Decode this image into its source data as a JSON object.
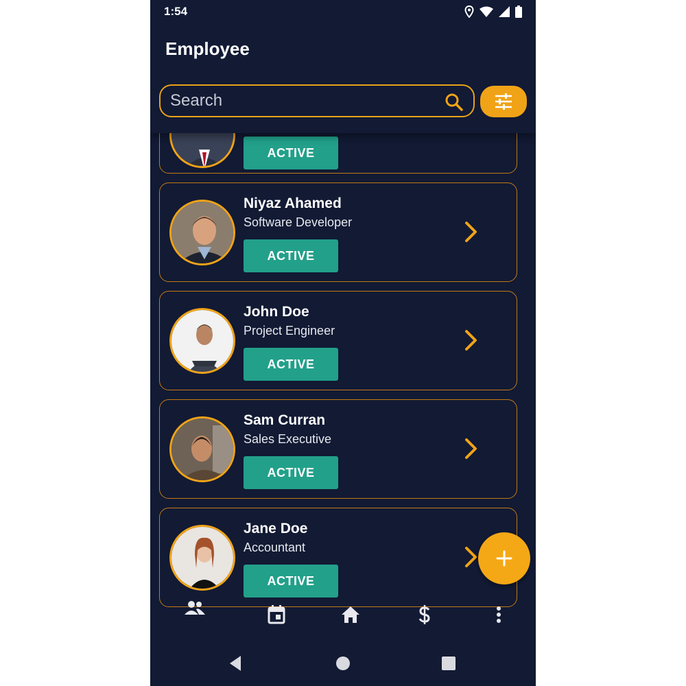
{
  "status": {
    "time": "1:54"
  },
  "app": {
    "title": "Employee"
  },
  "search": {
    "placeholder": "Search"
  },
  "employees": [
    {
      "name": "",
      "role": "",
      "status": "ACTIVE"
    },
    {
      "name": "Niyaz Ahamed",
      "role": "Software Developer",
      "status": "ACTIVE"
    },
    {
      "name": "John Doe",
      "role": "Project Engineer",
      "status": "ACTIVE"
    },
    {
      "name": "Sam Curran",
      "role": "Sales Executive",
      "status": "ACTIVE"
    },
    {
      "name": "Jane Doe",
      "role": "Accountant",
      "status": "ACTIVE"
    }
  ],
  "bottom_nav": [
    {
      "icon": "people-icon"
    },
    {
      "icon": "calendar-icon"
    },
    {
      "icon": "home-icon"
    },
    {
      "icon": "dollar-icon"
    },
    {
      "icon": "more-vert-icon"
    }
  ],
  "colors": {
    "background": "#121a34",
    "accent": "#f0a317",
    "badge": "#22a08a"
  }
}
